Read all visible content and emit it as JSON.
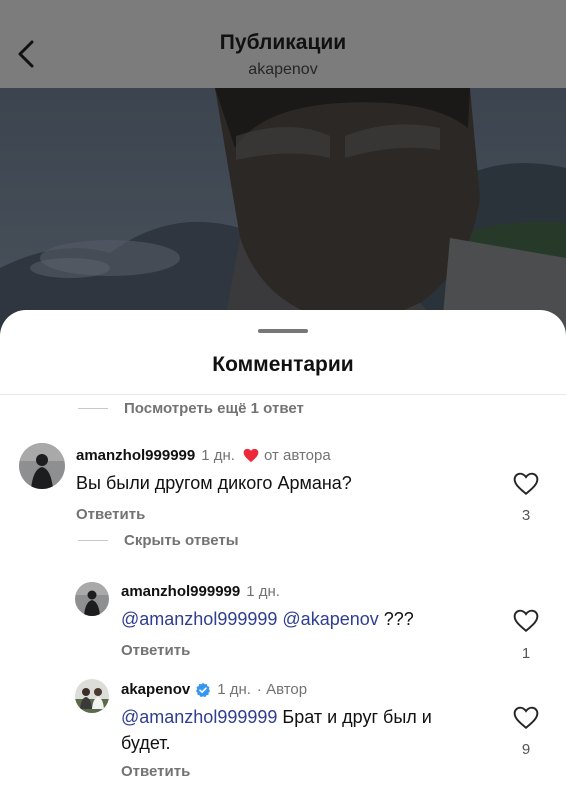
{
  "header": {
    "title": "Публикации",
    "subtitle": "akapenov"
  },
  "sheet": {
    "title": "Комментарии",
    "view_more_replies": "Посмотреть ещё 1 ответ",
    "hide_replies": "Скрыть ответы"
  },
  "comments": [
    {
      "username": "amanzhol999999",
      "time": "1 дн.",
      "author_liked_label": "от автора",
      "text": "Вы были другом дикого Армана?",
      "reply_label": "Ответить",
      "likes": "3"
    }
  ],
  "replies": [
    {
      "username": "amanzhol999999",
      "time": "1 дн.",
      "mention1": "@amanzhol999999",
      "mention2": "@akapenov",
      "text": "???",
      "reply_label": "Ответить",
      "likes": "1"
    },
    {
      "username": "akapenov",
      "time": "1 дн.",
      "author_tag": "· Автор",
      "mention1": "@amanzhol999999",
      "text_line1": "Брат и друг был и",
      "text_line2": "будет.",
      "reply_label": "Ответить",
      "likes": "9"
    }
  ],
  "colors": {
    "mention": "#2f3e8f",
    "heart_red": "#ed2939",
    "verified_blue": "#3797f0",
    "muted": "#737373"
  }
}
